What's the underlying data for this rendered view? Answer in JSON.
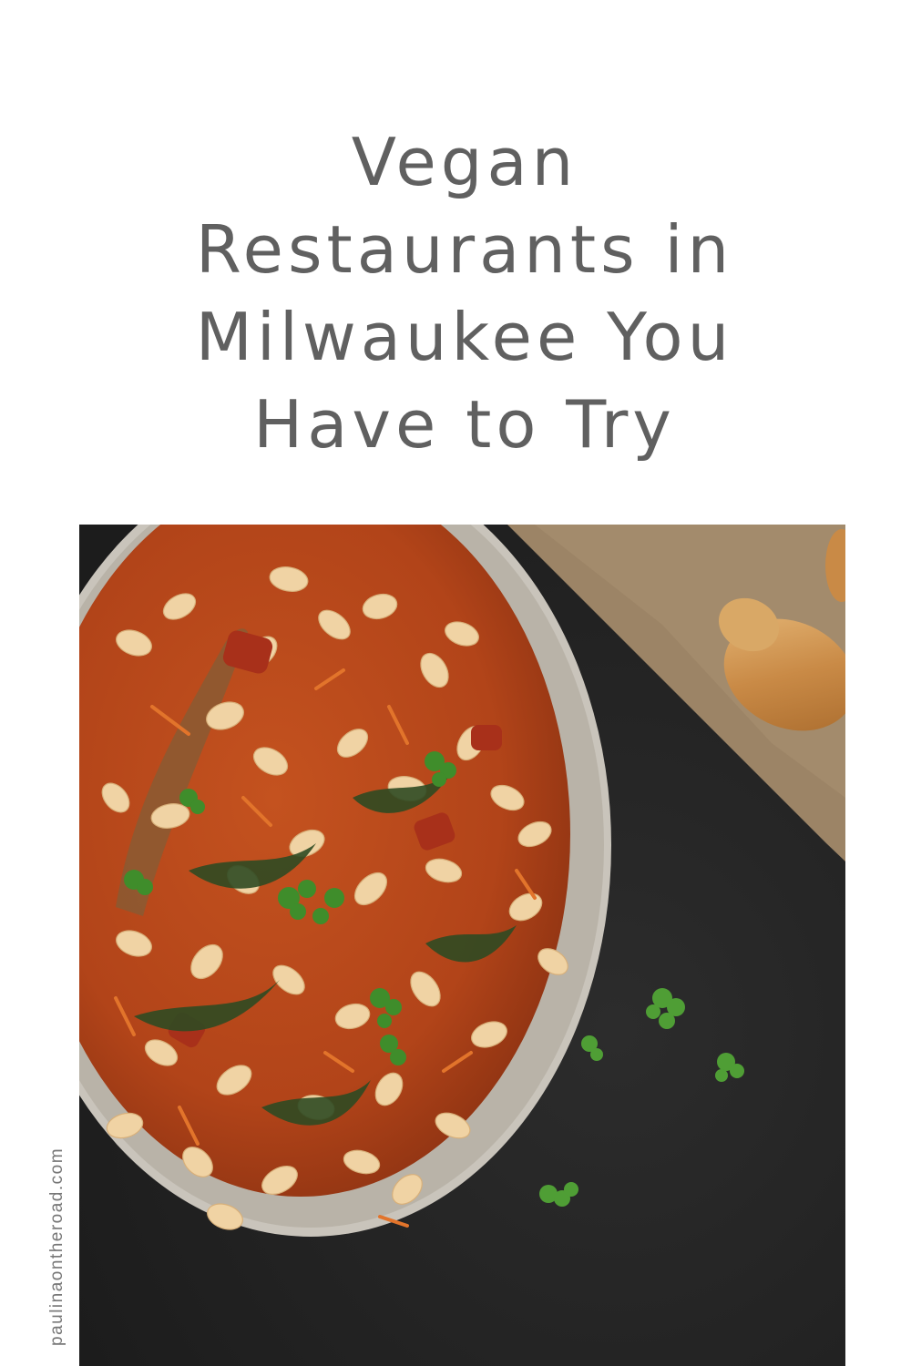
{
  "title": {
    "lines": [
      "Vegan",
      "Restaurants in",
      "Milwaukee You",
      "Have to Try"
    ]
  },
  "photo": {
    "subject": "bean-stew-bowl"
  },
  "watermark": {
    "text": "paulinaontheroad.com"
  },
  "colors": {
    "title_text": "#606060",
    "background": "#ffffff",
    "slate": "#242424",
    "stew": "#b8471e",
    "bowl_rim": "#c9c4bb",
    "bean": "#f0d3a4",
    "herb": "#3f8d2b",
    "paper": "#9c8466"
  }
}
